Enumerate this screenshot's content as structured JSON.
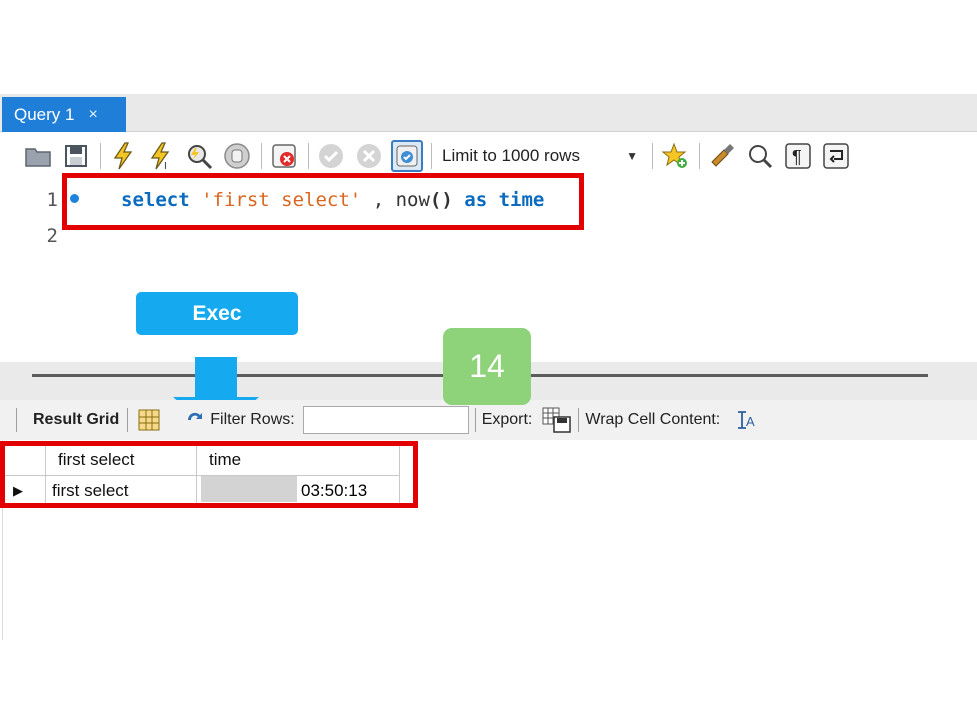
{
  "tab": {
    "label": "Query 1",
    "close_glyph": "×"
  },
  "toolbar": {
    "icons": [
      "open-folder-icon",
      "save-icon",
      "execute-icon",
      "execute-current-icon",
      "explain-icon",
      "stop-icon",
      "toggle-error-icon",
      "commit-icon",
      "rollback-icon",
      "autocommit-icon",
      "favorite-icon",
      "beautify-icon",
      "find-icon",
      "invisible-chars-icon",
      "wrap-icon"
    ],
    "limit_label": "Limit to 1000 rows"
  },
  "editor": {
    "line_numbers": [
      "1",
      "2"
    ],
    "code": {
      "kw_select": "select",
      "string": "'first select'",
      "comma": " , ",
      "fn": "now",
      "parens": "()",
      "kw_as": "as",
      "kw_time": "time"
    }
  },
  "callouts": {
    "exec": "Exec",
    "step_number": "14"
  },
  "result_toolbar": {
    "result_grid": "Result Grid",
    "filter_rows": "Filter Rows:",
    "export": "Export:",
    "wrap_cell": "Wrap Cell Content:"
  },
  "grid": {
    "columns": [
      "first select",
      "time"
    ],
    "rows": [
      {
        "first_select": "first select",
        "time": "03:50:13"
      }
    ]
  },
  "colors": {
    "accent_blue": "#1f7fd8",
    "highlight_red": "#e20000",
    "exec_blue": "#15aaef",
    "badge_green": "#8ed27a"
  }
}
